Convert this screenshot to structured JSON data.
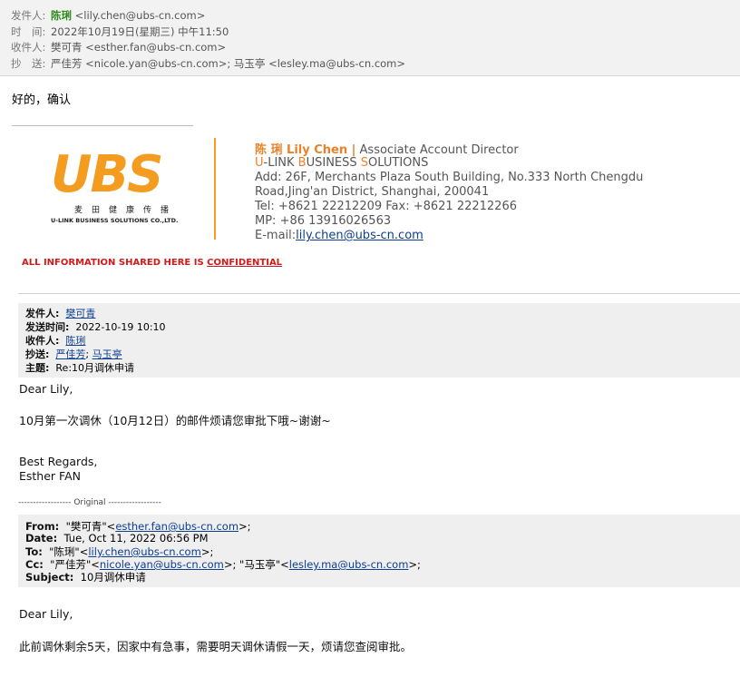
{
  "header": {
    "from_label": "发件人:",
    "from_name": "陈琍",
    "from_email": "<lily.chen@ubs-cn.com>",
    "time_label": "时　间:",
    "time_value": "2022年10月19日(星期三) 中午11:50",
    "to_label": "收件人:",
    "to_value": "樊可青 <esther.fan@ubs-cn.com>",
    "cc_label": "抄　送:",
    "cc_value": "严佳芳 <nicole.yan@ubs-cn.com>; 马玉亭 <lesley.ma@ubs-cn.com>"
  },
  "reply_text": "好的，确认",
  "signature": {
    "logo_text": "UBS",
    "logo_cn": "麦田健康传播",
    "logo_en": "U-LINK BUSINESS SOLUTIONS CO.,LTD.",
    "name": "陈 琍 Lily Chen |",
    "title": "Associate Account Director",
    "company_u": "U",
    "company_1": "-LINK ",
    "company_b": "B",
    "company_2": "USINESS ",
    "company_s": "S",
    "company_3": "OLUTIONS",
    "address_1": "Add:  26F,  Merchants  Plaza  South  Building,  No.333  North  Chengdu",
    "address_2": "Road,Jing'an District, Shanghai, 200041",
    "tel": "Tel: +8621 22212209  Fax: +8621 22212266",
    "mp": "MP: +86 13916026563",
    "email_label": "E-mail:",
    "email": "lily.chen@ubs-cn.com",
    "confidential_prefix": "ALL INFORMATION SHARED HERE IS ",
    "confidential_word": "CONFIDENTIAL"
  },
  "quote1": {
    "from_label": "发件人:",
    "from": "樊可青",
    "sent_label": "发送时间:",
    "sent": "2022-10-19 10:10",
    "to_label": "收件人:",
    "to": "陈琍",
    "cc_label": "抄送:",
    "cc_1": "严佳芳",
    "cc_sep": "; ",
    "cc_2": "马玉亭",
    "subject_label": "主题:",
    "subject": "Re:10月调休申请",
    "greeting": "Dear Lily,",
    "body": "10月第一次调休（10月12日）的邮件烦请您审批下哦~谢谢~",
    "regards": "Best Regards,",
    "sign": "Esther FAN"
  },
  "original_divider": "------------------ Original ------------------",
  "quote2": {
    "from_label": "From:",
    "from_name": "\"樊可青\"<",
    "from_email": "esther.fan@ubs-cn.com",
    "from_end": ">;",
    "date_label": "Date:",
    "date": "Tue, Oct 11, 2022 06:56 PM",
    "to_label": "To:",
    "to_name": "\"陈琍\"<",
    "to_email": "lily.chen@ubs-cn.com",
    "to_end": ">;",
    "cc_label": "Cc:",
    "cc_name1": "\"严佳芳\"<",
    "cc_email1": "nicole.yan@ubs-cn.com",
    "cc_mid": ">; \"马玉亭\"<",
    "cc_email2": "lesley.ma@ubs-cn.com",
    "cc_end": ">;",
    "subject_label": "Subject:",
    "subject": "10月调休申请",
    "greeting": "Dear Lily,",
    "body": "此前调休剩余5天，因家中有急事，需要明天调休请假一天，烦请您查阅审批。"
  },
  "colors": {
    "accent_orange": "#f39c1f",
    "sender_green": "#2e8b1e",
    "link_blue": "#0b3d91",
    "confidential_red": "#d4191a"
  }
}
